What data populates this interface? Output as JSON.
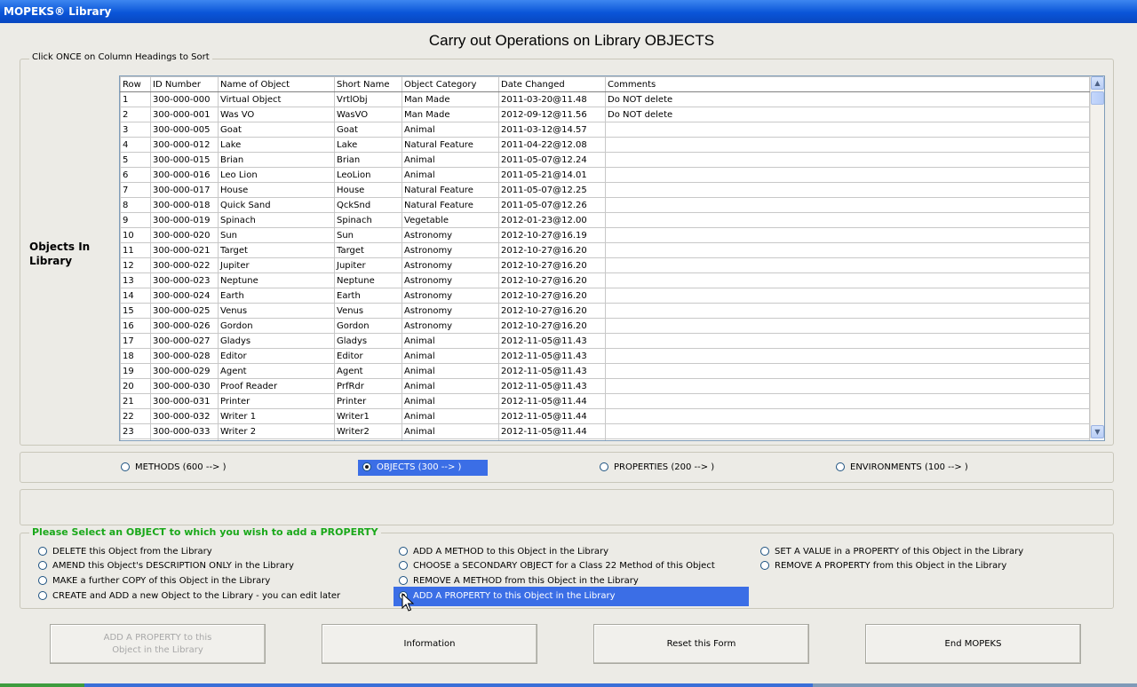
{
  "window": {
    "title": "MOPEKS® Library"
  },
  "form_title": "Carry out Operations on Library OBJECTS",
  "grid_section": {
    "legend": "Click ONCE on Column Headings to Sort",
    "side_label": "Objects In Library",
    "columns": [
      "Row",
      "ID Number",
      "Name of Object",
      "Short Name",
      "Object Category",
      "Date Changed",
      "Comments"
    ],
    "rows": [
      [
        "1",
        "300-000-000",
        "Virtual Object",
        "VrtlObj",
        "Man Made",
        "2011-03-20@11.48",
        "Do NOT delete"
      ],
      [
        "2",
        "300-000-001",
        "Was VO",
        "WasVO",
        "Man Made",
        "2012-09-12@11.56",
        "Do NOT delete"
      ],
      [
        "3",
        "300-000-005",
        "Goat",
        "Goat",
        "Animal",
        "2011-03-12@14.57",
        ""
      ],
      [
        "4",
        "300-000-012",
        "Lake",
        "Lake",
        "Natural Feature",
        "2011-04-22@12.08",
        ""
      ],
      [
        "5",
        "300-000-015",
        "Brian",
        "Brian",
        "Animal",
        "2011-05-07@12.24",
        ""
      ],
      [
        "6",
        "300-000-016",
        "Leo Lion",
        "LeoLion",
        "Animal",
        "2011-05-21@14.01",
        ""
      ],
      [
        "7",
        "300-000-017",
        "House",
        "House",
        "Natural Feature",
        "2011-05-07@12.25",
        ""
      ],
      [
        "8",
        "300-000-018",
        "Quick Sand",
        "QckSnd",
        "Natural Feature",
        "2011-05-07@12.26",
        ""
      ],
      [
        "9",
        "300-000-019",
        "Spinach",
        "Spinach",
        "Vegetable",
        "2012-01-23@12.00",
        ""
      ],
      [
        "10",
        "300-000-020",
        "Sun",
        "Sun",
        "Astronomy",
        "2012-10-27@16.19",
        ""
      ],
      [
        "11",
        "300-000-021",
        "Target",
        "Target",
        "Astronomy",
        "2012-10-27@16.20",
        ""
      ],
      [
        "12",
        "300-000-022",
        "Jupiter",
        "Jupiter",
        "Astronomy",
        "2012-10-27@16.20",
        ""
      ],
      [
        "13",
        "300-000-023",
        "Neptune",
        "Neptune",
        "Astronomy",
        "2012-10-27@16.20",
        ""
      ],
      [
        "14",
        "300-000-024",
        "Earth",
        "Earth",
        "Astronomy",
        "2012-10-27@16.20",
        ""
      ],
      [
        "15",
        "300-000-025",
        "Venus",
        "Venus",
        "Astronomy",
        "2012-10-27@16.20",
        ""
      ],
      [
        "16",
        "300-000-026",
        "Gordon",
        "Gordon",
        "Astronomy",
        "2012-10-27@16.20",
        ""
      ],
      [
        "17",
        "300-000-027",
        "Gladys",
        "Gladys",
        "Animal",
        "2012-11-05@11.43",
        ""
      ],
      [
        "18",
        "300-000-028",
        "Editor",
        "Editor",
        "Animal",
        "2012-11-05@11.43",
        ""
      ],
      [
        "19",
        "300-000-029",
        "Agent",
        "Agent",
        "Animal",
        "2012-11-05@11.43",
        ""
      ],
      [
        "20",
        "300-000-030",
        "Proof Reader",
        "PrfRdr",
        "Animal",
        "2012-11-05@11.43",
        ""
      ],
      [
        "21",
        "300-000-031",
        "Printer",
        "Printer",
        "Animal",
        "2012-11-05@11.44",
        ""
      ],
      [
        "22",
        "300-000-032",
        "Writer 1",
        "Writer1",
        "Animal",
        "2012-11-05@11.44",
        ""
      ],
      [
        "23",
        "300-000-033",
        "Writer 2",
        "Writer2",
        "Animal",
        "2012-11-05@11.44",
        ""
      ],
      [
        "24",
        "",
        "",
        "",
        "",
        "",
        ""
      ]
    ]
  },
  "type_options": {
    "methods": "METHODS (600 --> )",
    "objects": "OBJECTS (300 --> )",
    "properties": "PROPERTIES (200 --> )",
    "environments": "ENVIRONMENTS (100 --> )",
    "selected": "objects"
  },
  "operations": {
    "legend": "Please Select an OBJECT to which you wish to add a PROPERTY",
    "col1": [
      "DELETE this Object from the Library",
      "AMEND this Object's DESCRIPTION ONLY in the Library",
      "MAKE a further COPY of this Object in the Library",
      "CREATE and ADD a new Object to the Library - you can edit later"
    ],
    "col2": [
      "ADD A METHOD to this Object in the Library",
      "CHOOSE a SECONDARY OBJECT for a Class 22 Method of this Object",
      "REMOVE A METHOD from this Object in the Library",
      "ADD A PROPERTY to this Object in the Library"
    ],
    "col3": [
      "SET A VALUE in a PROPERTY of this Object in the Library",
      "REMOVE A PROPERTY from this Object in the Library"
    ],
    "selected": "ADD A PROPERTY to this Object in the Library"
  },
  "buttons": {
    "action_line1": "ADD A PROPERTY to this",
    "action_line2": "Object in the Library",
    "information": "Information",
    "reset": "Reset this Form",
    "end": "End MOPEKS"
  },
  "colors": {
    "selection": "#3b6ee6",
    "legend_green": "#1aa81a",
    "titlebar": "#0a55d8"
  }
}
